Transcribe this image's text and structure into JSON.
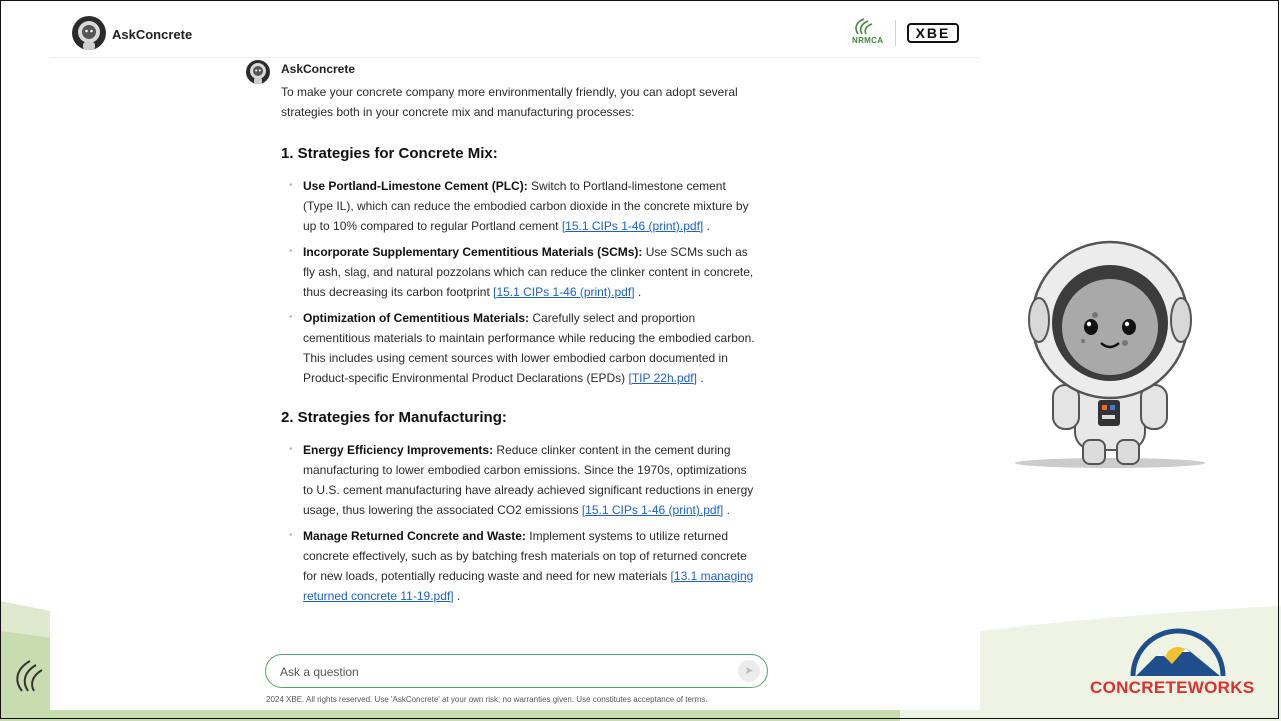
{
  "header": {
    "brand_name": "AskConcrete",
    "partner_logo_text": "NRMCA",
    "partner_logo_2_text": "XBE"
  },
  "message": {
    "author": "AskConcrete",
    "intro": "To make your concrete company more environmentally friendly, you can adopt several strategies both in your concrete mix and manufacturing processes:",
    "sections": [
      {
        "heading": "1. Strategies for Concrete Mix:",
        "items": [
          {
            "title": "Use Portland-Limestone Cement (PLC):",
            "text": " Switch to Portland-limestone cement (Type IL), which can reduce the embodied carbon dioxide in the concrete mixture by up to 10% compared to regular Portland cement ",
            "citation": "15.1 CIPs 1-46 (print).pdf",
            "end": " ."
          },
          {
            "title": "Incorporate Supplementary Cementitious Materials (SCMs):",
            "text": " Use SCMs such as fly ash, slag, and natural pozzolans which can reduce the clinker content in concrete, thus decreasing its carbon footprint ",
            "citation": "15.1 CIPs 1-46 (print).pdf",
            "end": " ."
          },
          {
            "title": "Optimization of Cementitious Materials:",
            "text": " Carefully select and proportion cementitious materials to maintain performance while reducing the embodied carbon. This includes using cement sources with lower embodied carbon documented in Product-specific Environmental Product Declarations (EPDs) ",
            "citation": "TIP 22h.pdf",
            "end": " ."
          }
        ]
      },
      {
        "heading": "2. Strategies for Manufacturing:",
        "items": [
          {
            "title": "Energy Efficiency Improvements:",
            "text": " Reduce clinker content in the cement during manufacturing to lower embodied carbon emissions. Since the 1970s, optimizations to U.S. cement manufacturing have already achieved significant reductions in energy usage, thus lowering the associated CO2 emissions ",
            "citation": "15.1 CIPs 1-46 (print).pdf",
            "end": " ."
          },
          {
            "title": "Manage Returned Concrete and Waste:",
            "text": " Implement systems to utilize returned concrete effectively, such as by batching fresh materials on top of returned concrete for new loads, potentially reducing waste and need for new materials ",
            "citation": "13.1 managing returned concrete 11-19.pdf",
            "end": " ."
          }
        ]
      }
    ]
  },
  "composer": {
    "placeholder": "Ask a question",
    "send_icon": "send-icon"
  },
  "footer": {
    "note": "2024 XBE. All rights reserved. Use 'AskConcrete' at your own risk; no warranties given. Use constitutes acceptance of terms."
  },
  "slide": {
    "event_logo_small": "NRMCA'S · 2024",
    "event_logo_text": "CONCRETEWORKS"
  },
  "colors": {
    "accent_green": "#5aa06a",
    "link_blue": "#1a5fd6",
    "event_red": "#d7322d"
  }
}
